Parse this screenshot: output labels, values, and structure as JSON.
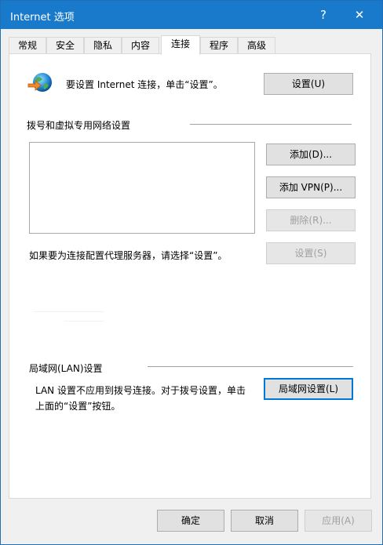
{
  "window": {
    "title": "Internet 选项",
    "help_glyph": "?",
    "close_glyph": "✕"
  },
  "tabs": [
    {
      "label": "常规"
    },
    {
      "label": "安全"
    },
    {
      "label": "隐私"
    },
    {
      "label": "内容"
    },
    {
      "label": "连接"
    },
    {
      "label": "程序"
    },
    {
      "label": "高级"
    }
  ],
  "active_tab": "连接",
  "setup": {
    "text": "要设置 Internet 连接，单击“设置”。",
    "button": "设置(U)"
  },
  "dialup": {
    "heading": "拨号和虚拟专用网络设置",
    "add_button": "添加(D)...",
    "add_vpn_button": "添加 VPN(P)...",
    "delete_button": "删除(R)...",
    "proxy_text": "如果要为连接配置代理服务器，请选择“设置”。",
    "settings_button": "设置(S)"
  },
  "lan": {
    "heading": "局域网(LAN)设置",
    "text_line1": "LAN 设置不应用到拨号连接。对于拨号设置，单击",
    "text_line2": "上面的“设置”按钮。",
    "button": "局域网设置(L)"
  },
  "footer": {
    "ok": "确定",
    "cancel": "取消",
    "apply": "应用(A)"
  },
  "colors": {
    "titlebar": "#1979ca",
    "focus": "#0078d7"
  }
}
